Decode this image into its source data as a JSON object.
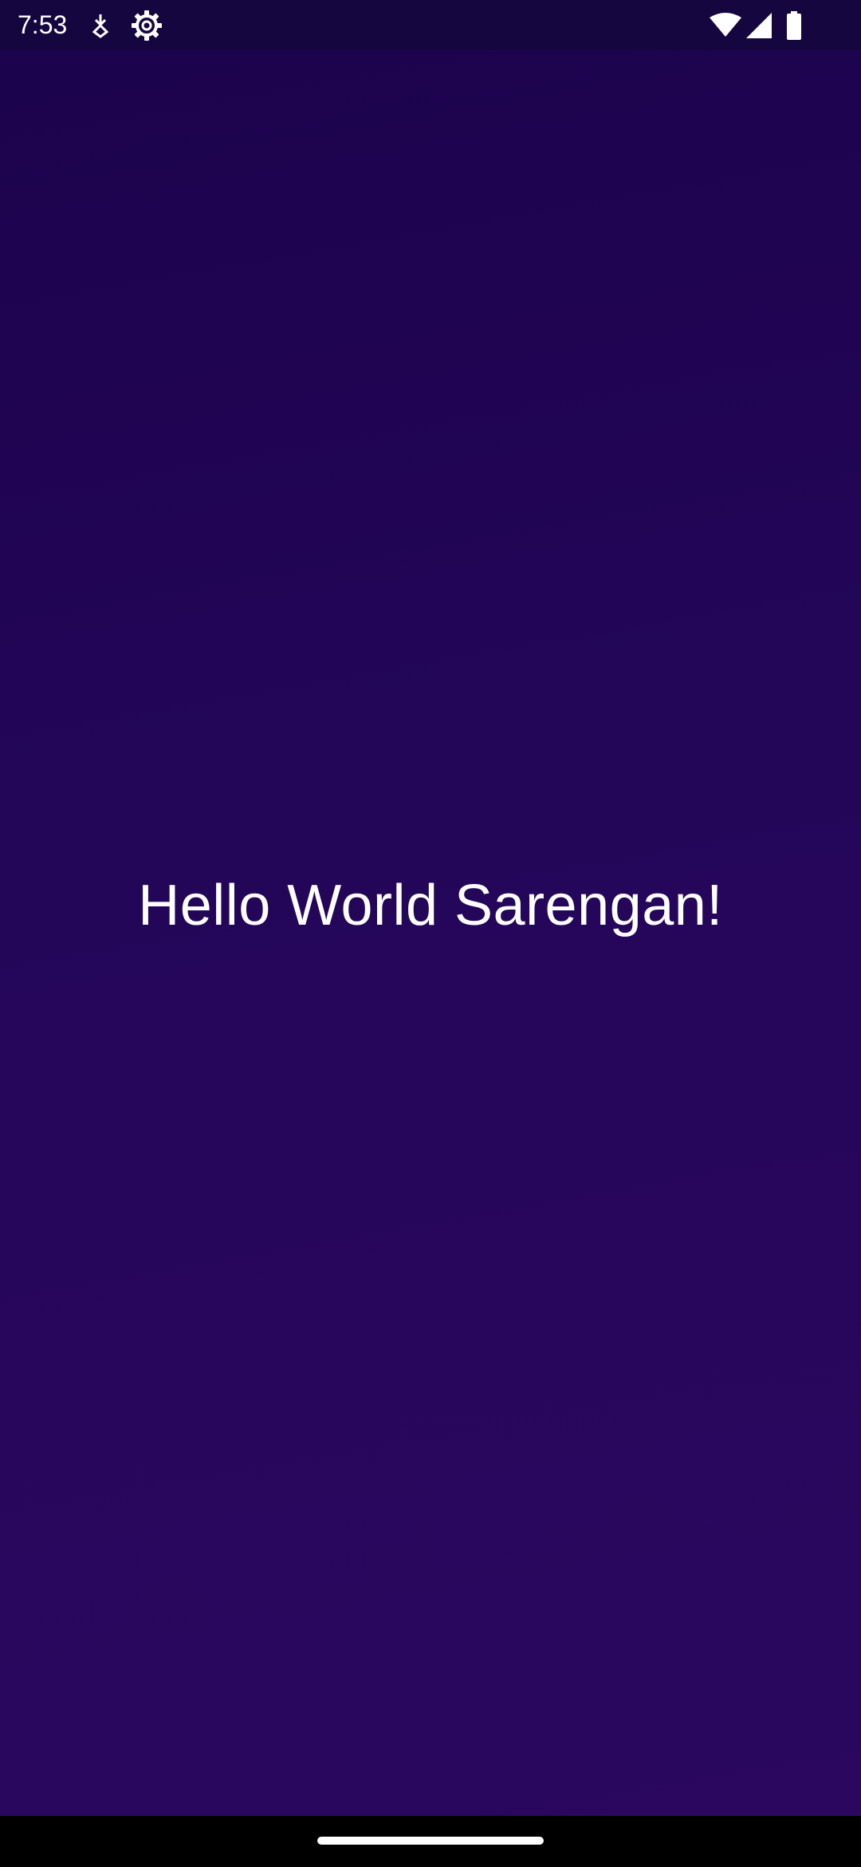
{
  "status_bar": {
    "time": "7:53",
    "left_icons": [
      "download-indicator-icon",
      "settings-gear-icon"
    ],
    "right_icons": [
      "wifi-icon",
      "cellular-signal-icon",
      "battery-icon"
    ]
  },
  "app": {
    "message": "Hello World Sarengan!"
  },
  "colors": {
    "status_bar": "#16063f",
    "background_top": "#1c034d",
    "background_bottom": "#2b075f",
    "text": "#ffffff",
    "navigation_bar": "#000000"
  }
}
